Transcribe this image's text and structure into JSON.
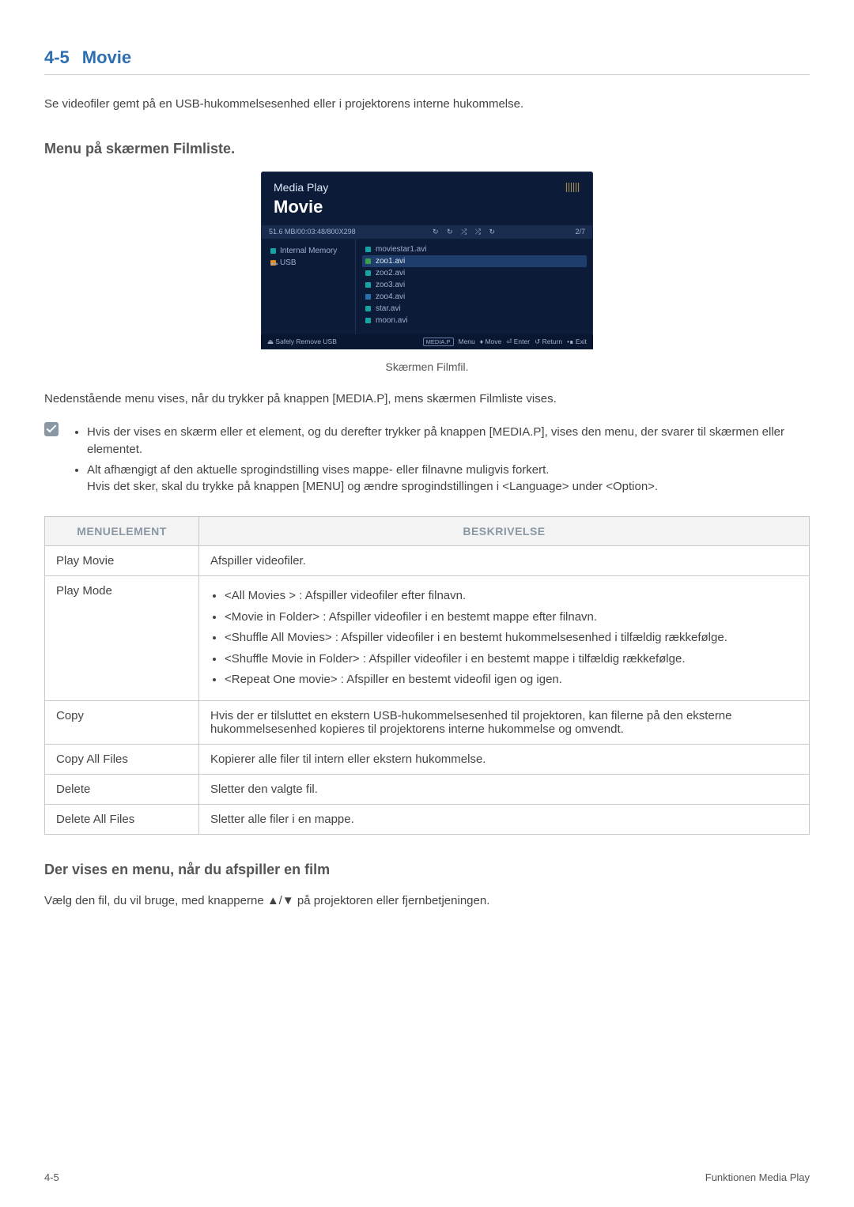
{
  "section": {
    "number": "4-5",
    "title": "Movie"
  },
  "intro": "Se videofiler gemt på en USB-hukommelsesenhed eller i projektorens interne hukommelse.",
  "sub1": "Menu på skærmen Filmliste.",
  "mp": {
    "mediaplay": "Media Play",
    "movie": "Movie",
    "info": "51.6 MB/00:03:48/800X298",
    "glyphs": "↻ ↻ ⤮ ⤮ ↻",
    "pager": "2/7",
    "side": {
      "internal": "Internal Memory",
      "usb": "USB"
    },
    "files": [
      "moviestar1.avi",
      "zoo1.avi",
      "zoo2.avi",
      "zoo3.avi",
      "zoo4.avi",
      "star.avi",
      "moon.avi"
    ],
    "footer": {
      "safely": "Safely Remove USB",
      "tag": "MEDIA.P",
      "menu": "Menu",
      "move": "Move",
      "enter": "Enter",
      "return": "Return",
      "exit": "Exit"
    }
  },
  "caption": "Skærmen Filmfil.",
  "para_after_caption": "Nedenstående menu vises, når du trykker på knappen [MEDIA.P], mens skærmen Filmliste vises.",
  "notes": {
    "b1": "Hvis der vises en skærm eller et element, og du derefter trykker på knappen [MEDIA.P], vises den menu, der svarer til skærmen eller elementet.",
    "b2a": "Alt afhængigt af den aktuelle sprogindstilling vises mappe- eller filnavne muligvis forkert.",
    "b2b": "Hvis det sker, skal du trykke på knappen [MENU] og ændre sprogindstillingen i <Language> under <Option>."
  },
  "table": {
    "h1": "MENUELEMENT",
    "h2": "BESKRIVELSE",
    "rows": {
      "r1": {
        "label": "Play Movie",
        "desc": "Afspiller videofiler."
      },
      "r2": {
        "label": "Play Mode",
        "items": [
          "<All Movies > : Afspiller videofiler efter filnavn.",
          "<Movie in Folder> : Afspiller videofiler i en bestemt mappe efter filnavn.",
          "<Shuffle All Movies> : Afspiller videofiler i en bestemt hukommelsesenhed i tilfældig rækkefølge.",
          "<Shuffle Movie in Folder> : Afspiller videofiler i en bestemt mappe i tilfældig rækkefølge.",
          "<Repeat One movie> : Afspiller en bestemt videofil igen og igen."
        ]
      },
      "r3": {
        "label": "Copy",
        "desc": "Hvis der er tilsluttet en ekstern USB-hukommelsesenhed til projektoren, kan filerne på den eksterne hukommelsesenhed kopieres til projektorens interne hukommelse og omvendt."
      },
      "r4": {
        "label": "Copy All Files",
        "desc": "Kopierer alle filer til intern eller ekstern hukommelse."
      },
      "r5": {
        "label": "Delete",
        "desc": "Sletter den valgte fil."
      },
      "r6": {
        "label": "Delete All Files",
        "desc": "Sletter alle filer i en mappe."
      }
    }
  },
  "sub2": "Der vises en menu, når du afspiller en film",
  "para2": "Vælg den fil, du vil bruge, med knapperne ▲/▼ på projektoren eller fjernbetjeningen.",
  "footer": {
    "left": "4-5",
    "right": "Funktionen Media Play"
  }
}
